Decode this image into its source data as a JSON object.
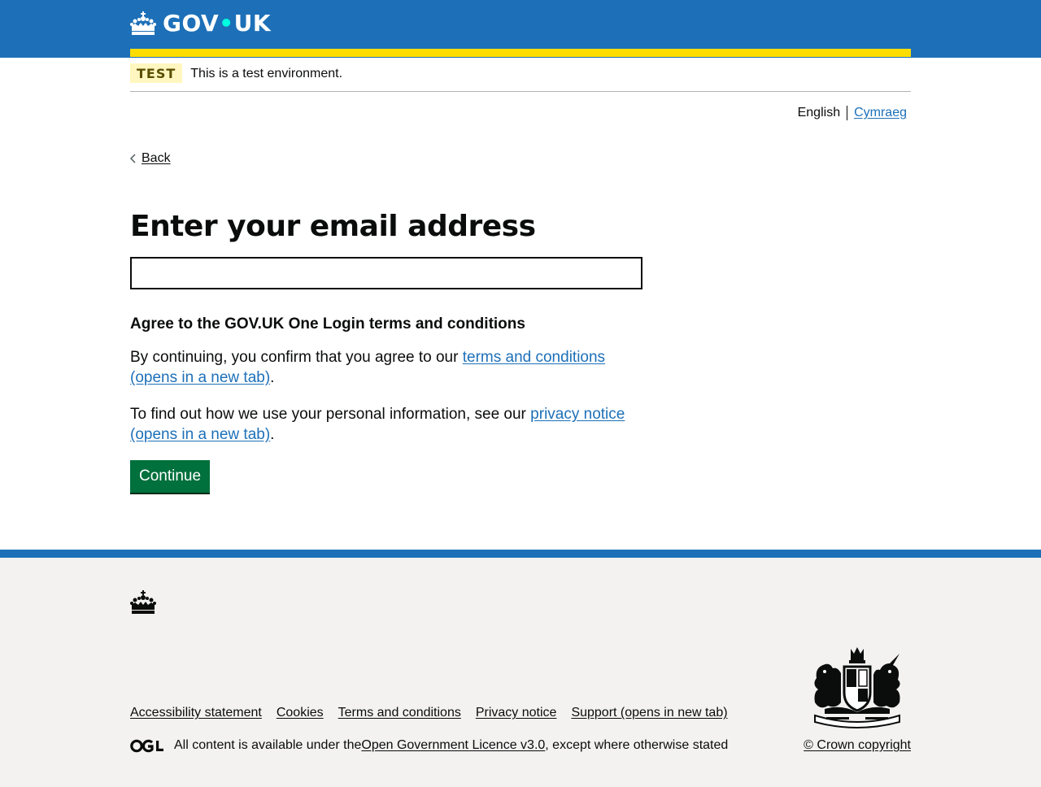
{
  "header": {
    "logo_text": "GOV",
    "logo_dot": "•",
    "logo_text2": "UK",
    "color": "#1d70b8",
    "accent": "#ffdd00"
  },
  "phase_banner": {
    "tag": "TEST",
    "text": "This is a test environment."
  },
  "language": {
    "current": "English",
    "other": "Cymraeg"
  },
  "back_link": "Back",
  "main": {
    "title": "Enter your email address",
    "email_value": "",
    "terms_heading": "Agree to the GOV.UK One Login terms and conditions",
    "para1_prefix": "By continuing, you confirm that you agree to our ",
    "para1_link": "terms and conditions (opens in a new tab)",
    "para1_suffix": ".",
    "para2_prefix": "To find out how we use your personal information, see our ",
    "para2_link": "privacy notice (opens in a new tab)",
    "para2_suffix": ".",
    "continue_label": "Continue",
    "button_color": "#00703c"
  },
  "footer": {
    "links": [
      "Accessibility statement",
      "Cookies",
      "Terms and conditions",
      "Privacy notice",
      "Support (opens in new tab)"
    ],
    "licence_prefix": "All content is available under the ",
    "licence_link": "Open Government Licence v3.0",
    "licence_suffix": ", except where otherwise stated",
    "copyright": "© Crown copyright"
  }
}
